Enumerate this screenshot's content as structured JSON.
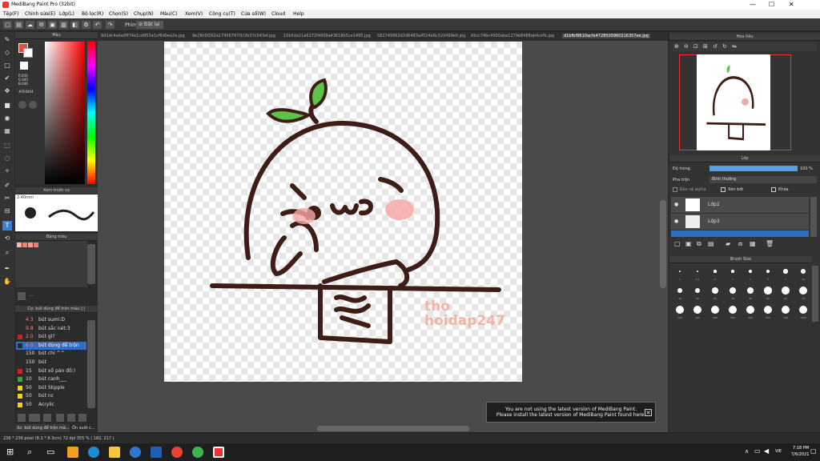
{
  "window": {
    "title": "MediBang Paint Pro (32bit)",
    "min": "—",
    "max": "☐",
    "close": "✕"
  },
  "menu": [
    "Tệp(F)",
    "Chỉnh sửa(E)",
    "Lớp(L)",
    "Bộ lọc(R)",
    "Chọn(S)",
    "Chụp(N)",
    "Màu(C)",
    "Xem(V)",
    "Công cụ(T)",
    "Cửa sổ(W)",
    "Cloud",
    "Help"
  ],
  "toolbar": {
    "phim_label": "Phím",
    "dat_lai_label": "Đặt lại"
  },
  "tabs": [
    "8d1dc4a6e0ff74e1cd953a1cf6d0ea2e.jpg",
    "9e28c0f262a17456797f1f2b37c543ef.jpg",
    "10b5da11a6272f4909a43618b5ce1495.jpg",
    "582749962d2d6483a4524e8c32d499e0.jpg",
    "b5cc74bc4900aba1279e8488ab4cefb.jpg",
    "d1bfbf9610acfa4728500960216357ee.jpg"
  ],
  "color_panel": {
    "title": "Màu",
    "r": "R:050",
    "g": "G:045",
    "b": "B:040",
    "hex": "#050404"
  },
  "brush_preview": {
    "title": "Xem trước cọ",
    "size": "2.40mm"
  },
  "palette": {
    "title": "Bảng màu"
  },
  "brush_list": {
    "title": "Cọ: bút dùng để trộn màu (;)",
    "items": [
      {
        "size": "4.3",
        "name": "bút sumi:D",
        "color": "#2a2a2a"
      },
      {
        "size": "9.8",
        "name": "bút sắc nét:3",
        "color": "#2a2a2a"
      },
      {
        "size": "2.0",
        "name": "bút gì?",
        "color": "#d32020"
      },
      {
        "size": "6.0",
        "name": "bút dùng để trộn",
        "color": "#2a2a2a"
      },
      {
        "size": "150",
        "name": "bút chì ^^",
        "color": "#2a2a2a"
      },
      {
        "size": "150",
        "name": "bút",
        "color": "#2a2a2a"
      },
      {
        "size": "15",
        "name": "bút xổ pán đồ:)",
        "color": "#d32020"
      },
      {
        "size": "10",
        "name": "bút canh___",
        "color": "#2ab02a"
      },
      {
        "size": "50",
        "name": "bút Stipple",
        "color": "#f0d020"
      },
      {
        "size": "50",
        "name": "bút nc",
        "color": "#f0d020"
      },
      {
        "size": "50",
        "name": "Acrylic",
        "color": "#f0d020"
      }
    ]
  },
  "bottom_tabs": [
    "Xz: bút dùng để trộn mà...",
    "Ốn suốt c..."
  ],
  "navigator": {
    "title": "Hoa tiêu",
    "watermark": "tho\nhoidap247"
  },
  "layer_panel": {
    "title": "Lớp",
    "opacity_label": "Độ trong",
    "opacity_value": "100 %",
    "blend_label": "Pha trộn",
    "blend_value": "Bình thường",
    "protect_alpha": "Bảo vệ alpha",
    "clipping": "Xén bớt",
    "lock": "Khóa",
    "layers": [
      "Lớp2",
      "Lớp3"
    ]
  },
  "brush_size": {
    "title": "Brush Size",
    "sizes": [
      "1",
      "1.5",
      "2",
      "3",
      "4",
      "5",
      "7",
      "10",
      "15",
      "20",
      "25",
      "30",
      "40",
      "50",
      "60",
      "70",
      "100",
      "150",
      "200",
      "300",
      "400",
      "500",
      "700",
      "1000"
    ]
  },
  "watermark": {
    "line1": "tho",
    "line2": "hoidap247"
  },
  "notice": {
    "line1": "You are not using the latest version of MediBang Paint.",
    "line2": "Please install the latest version of MediBang Paint found here."
  },
  "status": {
    "info": "236 * 236 pixel  (8.3 * 8.3cm)  72 dpi  355 %  ( 182, 217 )"
  },
  "taskbar": {
    "lang": "VIE",
    "time": "7:18 PM",
    "date": "7/6/2021"
  }
}
